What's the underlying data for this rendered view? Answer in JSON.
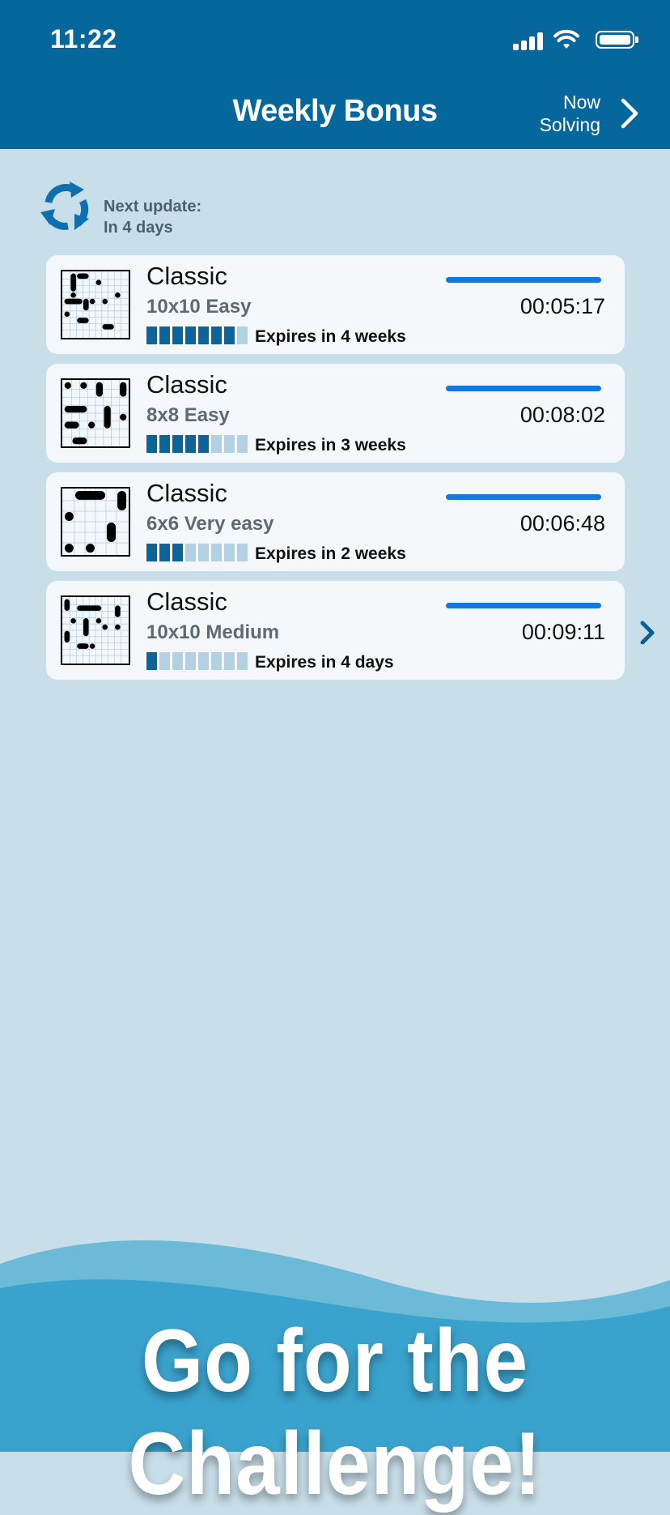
{
  "status_bar": {
    "time": "11:22"
  },
  "header": {
    "title": "Weekly Bonus",
    "now_solving_line1": "Now",
    "now_solving_line2": "Solving"
  },
  "update": {
    "line1": "Next update:",
    "line2": "In 4 days"
  },
  "puzzles": [
    {
      "title": "Classic",
      "subtitle": "10x10 Easy",
      "expires": "Expires in 4 weeks",
      "timer": "00:05:17",
      "segments_filled": 7,
      "segments_total": 8
    },
    {
      "title": "Classic",
      "subtitle": "8x8 Easy",
      "expires": "Expires in 3 weeks",
      "timer": "00:08:02",
      "segments_filled": 5,
      "segments_total": 8
    },
    {
      "title": "Classic",
      "subtitle": "6x6 Very easy",
      "expires": "Expires in 2 weeks",
      "timer": "00:06:48",
      "segments_filled": 3,
      "segments_total": 8
    },
    {
      "title": "Classic",
      "subtitle": "10x10 Medium",
      "expires": "Expires in 4 days",
      "timer": "00:09:11",
      "segments_filled": 1,
      "segments_total": 8
    }
  ],
  "banner": {
    "slogan": "Go for the Challenge!"
  },
  "colors": {
    "header": "#05679b",
    "background": "#c8dee9",
    "progress": "#1478e0",
    "segment_on": "#0c6498",
    "segment_off": "#b2d1e3"
  },
  "icons": [
    "refresh-icon",
    "chevron-right-icon",
    "signal-icon",
    "wifi-icon",
    "battery-icon"
  ]
}
